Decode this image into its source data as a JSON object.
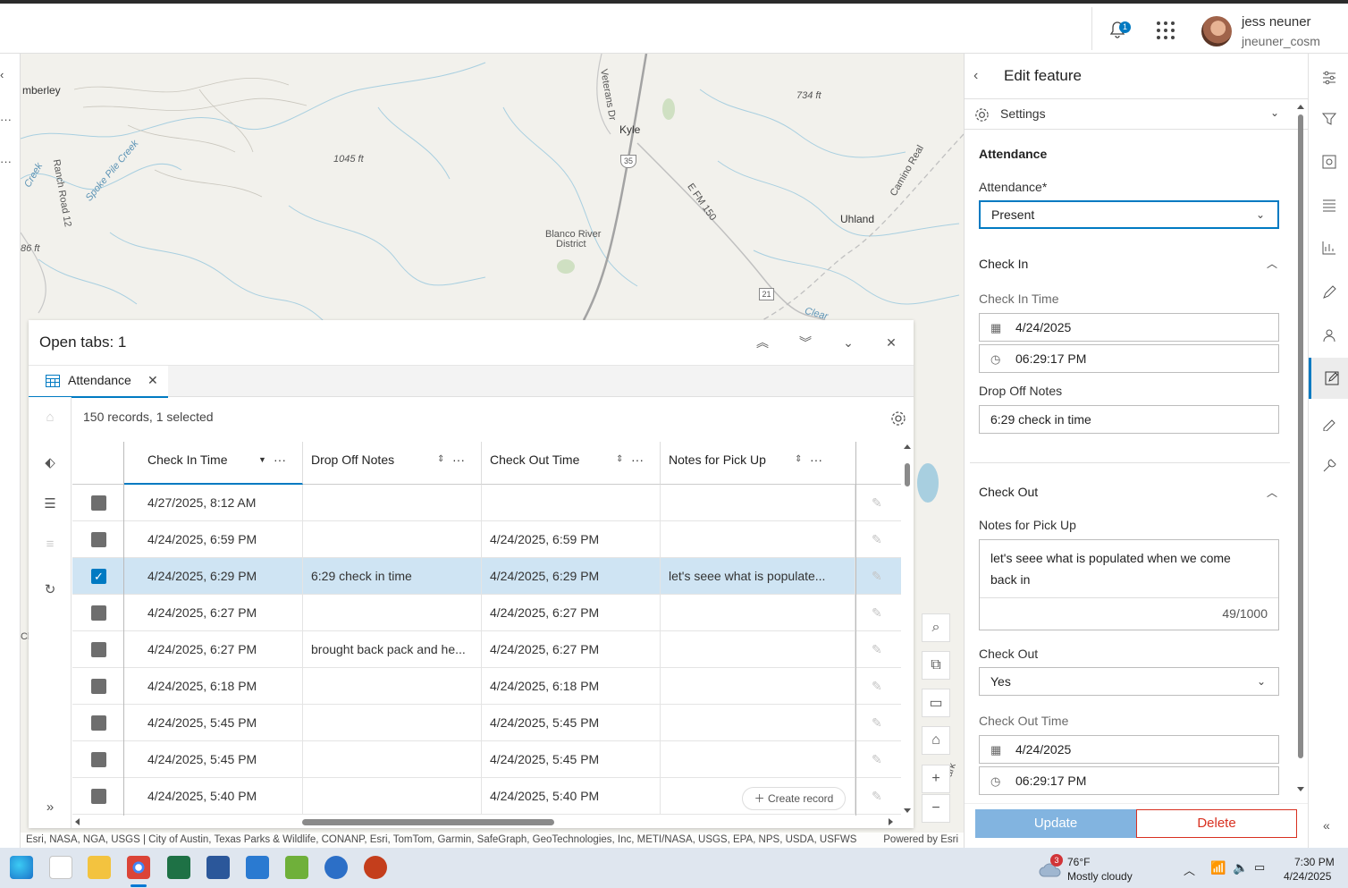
{
  "header": {
    "notification_count": "1",
    "user_name": "jess neuner",
    "user_id": "jneuner_cosm"
  },
  "map": {
    "labels": {
      "amberley": "mberley",
      "kyle": "Kyle",
      "uhland": "Uhland",
      "blanco1": "Blanco River",
      "blanco2": "District",
      "elev1045": "1045 ft",
      "elev734": "734 ft",
      "elev86": "86 ft",
      "veterans": "Veterans Dr",
      "fm150": "E FM 150",
      "camino": "Camino Real",
      "ranch": "Ranch Road 12",
      "spoke": "Spoke Pile Creek",
      "creek": "Creek",
      "clear": "Clear",
      "i35": "35",
      "r21": "21",
      "ch": "Ch",
      "park": "ark"
    },
    "attribution": "Esri, NASA, NGA, USGS | City of Austin, Texas Parks & Wildlife, CONANP, Esri, TomTom, Garmin, SafeGraph, GeoTechnologies, Inc, METI/NASA, USGS, EPA, NPS, USDA, USFWS",
    "powered": "Powered by Esri"
  },
  "table_panel": {
    "title": "Open tabs: 1",
    "tab_label": "Attendance",
    "records_text": "150 records, 1 selected",
    "columns": [
      "Check In Time",
      "Drop Off Notes",
      "Check Out Time",
      "Notes for Pick Up"
    ],
    "rows": [
      {
        "checked": false,
        "check_in": "4/27/2025, 8:12 AM",
        "drop_off": "",
        "check_out": "",
        "pick_up": ""
      },
      {
        "checked": false,
        "check_in": "4/24/2025, 6:59 PM",
        "drop_off": "",
        "check_out": "4/24/2025, 6:59 PM",
        "pick_up": ""
      },
      {
        "checked": true,
        "check_in": "4/24/2025, 6:29 PM",
        "drop_off": "6:29 check in time",
        "check_out": "4/24/2025, 6:29 PM",
        "pick_up": "let's seee what is populate..."
      },
      {
        "checked": false,
        "check_in": "4/24/2025, 6:27 PM",
        "drop_off": "",
        "check_out": "4/24/2025, 6:27 PM",
        "pick_up": ""
      },
      {
        "checked": false,
        "check_in": "4/24/2025, 6:27 PM",
        "drop_off": "brought back pack and he...",
        "check_out": "4/24/2025, 6:27 PM",
        "pick_up": ""
      },
      {
        "checked": false,
        "check_in": "4/24/2025, 6:18 PM",
        "drop_off": "",
        "check_out": "4/24/2025, 6:18 PM",
        "pick_up": ""
      },
      {
        "checked": false,
        "check_in": "4/24/2025, 5:45 PM",
        "drop_off": "",
        "check_out": "4/24/2025, 5:45 PM",
        "pick_up": ""
      },
      {
        "checked": false,
        "check_in": "4/24/2025, 5:45 PM",
        "drop_off": "",
        "check_out": "4/24/2025, 5:45 PM",
        "pick_up": ""
      },
      {
        "checked": false,
        "check_in": "4/24/2025, 5:40 PM",
        "drop_off": "",
        "check_out": "4/24/2025, 5:40 PM",
        "pick_up": ""
      }
    ],
    "create_record": "Create record"
  },
  "edit_panel": {
    "title": "Edit feature",
    "settings_label": "Settings",
    "section_attendance": "Attendance",
    "attendance_label": "Attendance*",
    "attendance_value": "Present",
    "section_check_in": "Check In",
    "check_in_time_label": "Check In Time",
    "check_in_date": "4/24/2025",
    "check_in_time": "06:29:17 PM",
    "drop_off_label": "Drop Off Notes",
    "drop_off_value": "6:29 check in time",
    "section_check_out": "Check Out",
    "pick_up_label": "Notes for Pick Up",
    "pick_up_value": "let's seee what is populated when we come back in",
    "pick_up_count": "49/1000",
    "check_out_label": "Check Out",
    "check_out_value": "Yes",
    "check_out_time_label": "Check Out Time",
    "check_out_date": "4/24/2025",
    "check_out_time": "06:29:17 PM",
    "update_label": "Update",
    "delete_label": "Delete"
  },
  "taskbar": {
    "weather_badge": "3",
    "temperature": "76°F",
    "weather": "Mostly cloudy",
    "time": "7:30 PM",
    "date": "4/24/2025"
  },
  "colors": {
    "accent": "#007ac2",
    "delete": "#d83020",
    "selected_row": "#cfe4f3",
    "update_disabled": "#82b4e0"
  }
}
